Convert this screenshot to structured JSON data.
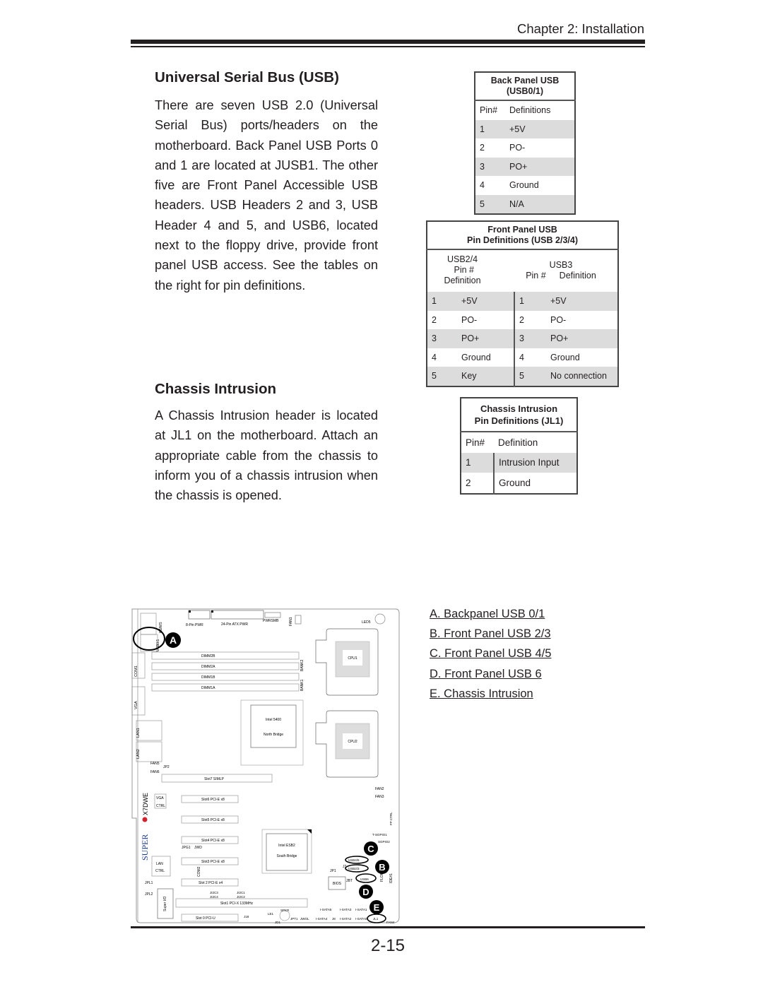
{
  "header": {
    "chapter": "Chapter 2: Installation"
  },
  "usb_section": {
    "title": "Universal Serial Bus (USB)",
    "body": "There are seven USB 2.0 (Universal Serial Bus) ports/headers on the motherboard. Back Panel USB Ports 0 and 1 are located at JUSB1. The other five are Front Panel Accessible USB headers. USB Headers 2 and 3, USB Header 4 and 5, and USB6, located next to the floppy drive, provide front panel USB access. See the tables on the right for pin definitions."
  },
  "chassis_section": {
    "title": "Chassis Intrusion",
    "body": "A Chassis Intrusion header is located at JL1 on the motherboard.  Attach an appropriate cable from the chassis to inform you of a chassis intrusion when the chassis is opened."
  },
  "back_panel_table": {
    "title_line1": "Back Panel USB",
    "title_line2": "(USB0/1)",
    "col_pin": "Pin#",
    "col_def": "Definitions",
    "rows": [
      {
        "pin": "1",
        "def": "+5V"
      },
      {
        "pin": "2",
        "def": "PO-"
      },
      {
        "pin": "3",
        "def": "PO+"
      },
      {
        "pin": "4",
        "def": "Ground"
      },
      {
        "pin": "5",
        "def": "N/A"
      }
    ]
  },
  "front_panel_table": {
    "title_line1": "Front Panel USB",
    "title_line2": "Pin Definitions (USB 2/3/4)",
    "group_a": "USB2/4",
    "group_b": "USB3",
    "col_pin": "Pin #",
    "col_def": "Definition",
    "rows": [
      {
        "pin_a": "1",
        "def_a": "+5V",
        "pin_b": "1",
        "def_b": "+5V"
      },
      {
        "pin_a": "2",
        "def_a": "PO-",
        "pin_b": "2",
        "def_b": "PO-"
      },
      {
        "pin_a": "3",
        "def_a": "PO+",
        "pin_b": "3",
        "def_b": "PO+"
      },
      {
        "pin_a": "4",
        "def_a": "Ground",
        "pin_b": "4",
        "def_b": "Ground"
      },
      {
        "pin_a": "5",
        "def_a": "Key",
        "pin_b": "5",
        "def_b": "No connection"
      }
    ]
  },
  "chassis_table": {
    "title_line1": "Chassis Intrusion",
    "title_line2": "Pin Definitions (JL1)",
    "col_pin": "Pin#",
    "col_def": "Definition",
    "rows": [
      {
        "pin": "1",
        "def": "Intrusion Input"
      },
      {
        "pin": "2",
        "def": "Ground"
      }
    ]
  },
  "legend": [
    "A. Backpanel USB 0/1",
    "B. Front Panel USB 2/3",
    "C. Front Panel USB 4/5",
    "D. Front Panel USB 6",
    "E. Chassis Intrusion"
  ],
  "board": {
    "brand": "SUPER",
    "model": "X7DWE",
    "callouts": [
      "A",
      "B",
      "C",
      "D",
      "E"
    ],
    "labels": {
      "pwr8": "8-Pin PWR",
      "atx": "24-Pin ATX PWR",
      "pwrsmb": "PWRSMB",
      "fan1": "FAN1",
      "led5": "LED5",
      "kbms": "KB/MS",
      "usb01": "USB0/1",
      "com1": "COM1",
      "vga": "VGA",
      "lan1": "LAN1",
      "lan2": "LAN2",
      "dimm2b": "DIMM2B",
      "dimm2a": "DIMM2A",
      "dimm1b": "DIMM1B",
      "dimm1a": "DIMM1A",
      "bank2": "BANK2",
      "bank1": "BANK1",
      "cpu1": "CPU1",
      "cpu2": "CPU2",
      "nb1": "Intel 5400",
      "nb2": "North Bridge",
      "sb1": "Intel ESB2",
      "sb2": "South Bridge",
      "fan5": "FAN5",
      "fan6": "FAN6",
      "jp2": "JP2",
      "fan2": "FAN2",
      "fan3": "FAN3",
      "slot7": "Slot7 SIMLP",
      "slot6": "Slot6 PCI-E x8",
      "slot5": "Slot5 PCI-E x8",
      "slot4": "Slot4 PCI-E x8",
      "slot3": "Slot3 PCI-E x8",
      "slot2": "Slot 2 PCI-E x4",
      "slot1": "Slot1 PCI-X 133MHz",
      "slot0": "Slot 0 PCI-U",
      "vga_ctrl1": "VGA",
      "vga_ctrl2": "CTRL",
      "lan_ctrl1": "LAN",
      "lan_ctrl2": "CTRL",
      "jpg1": "JPG1",
      "jwd": "JWD",
      "com2": "COM2",
      "jpl1": "JPL1",
      "jpl2": "JPL2",
      "superio": "Super I/O",
      "j2c3": "JI2C3",
      "j2c4": "JI2C4",
      "j2c1": "JI2C1",
      "j2c2": "JI2C2",
      "bios": "BIOS",
      "jbt": "JBT",
      "j7": "J7",
      "jp1": "JP1",
      "usb45": "USB4/5",
      "usb23": "USB2/3",
      "usb6": "USB6",
      "tsgpio1": "T-SGPIO1",
      "tsgpio2": "SGPIO2",
      "fpctrl": "FP CTRL",
      "floppy": "FLOPPY",
      "ide": "IDE#1",
      "sata0": "I-SATA0",
      "sata1": "I-SATA1",
      "sata2": "I-SATA2",
      "sata3": "I-SATA3",
      "sata4": "I-SATA4",
      "sata5": "I-SATA5",
      "jl1": "JL1",
      "fan4": "FAN4",
      "j18": "J18",
      "le1": "LE1",
      "spkr": "SPKR",
      "jd1": "JD1",
      "jwol": "JWOL",
      "jpt1": "JPT1",
      "j8": "J8"
    }
  },
  "footer": {
    "page_number": "2-15"
  }
}
